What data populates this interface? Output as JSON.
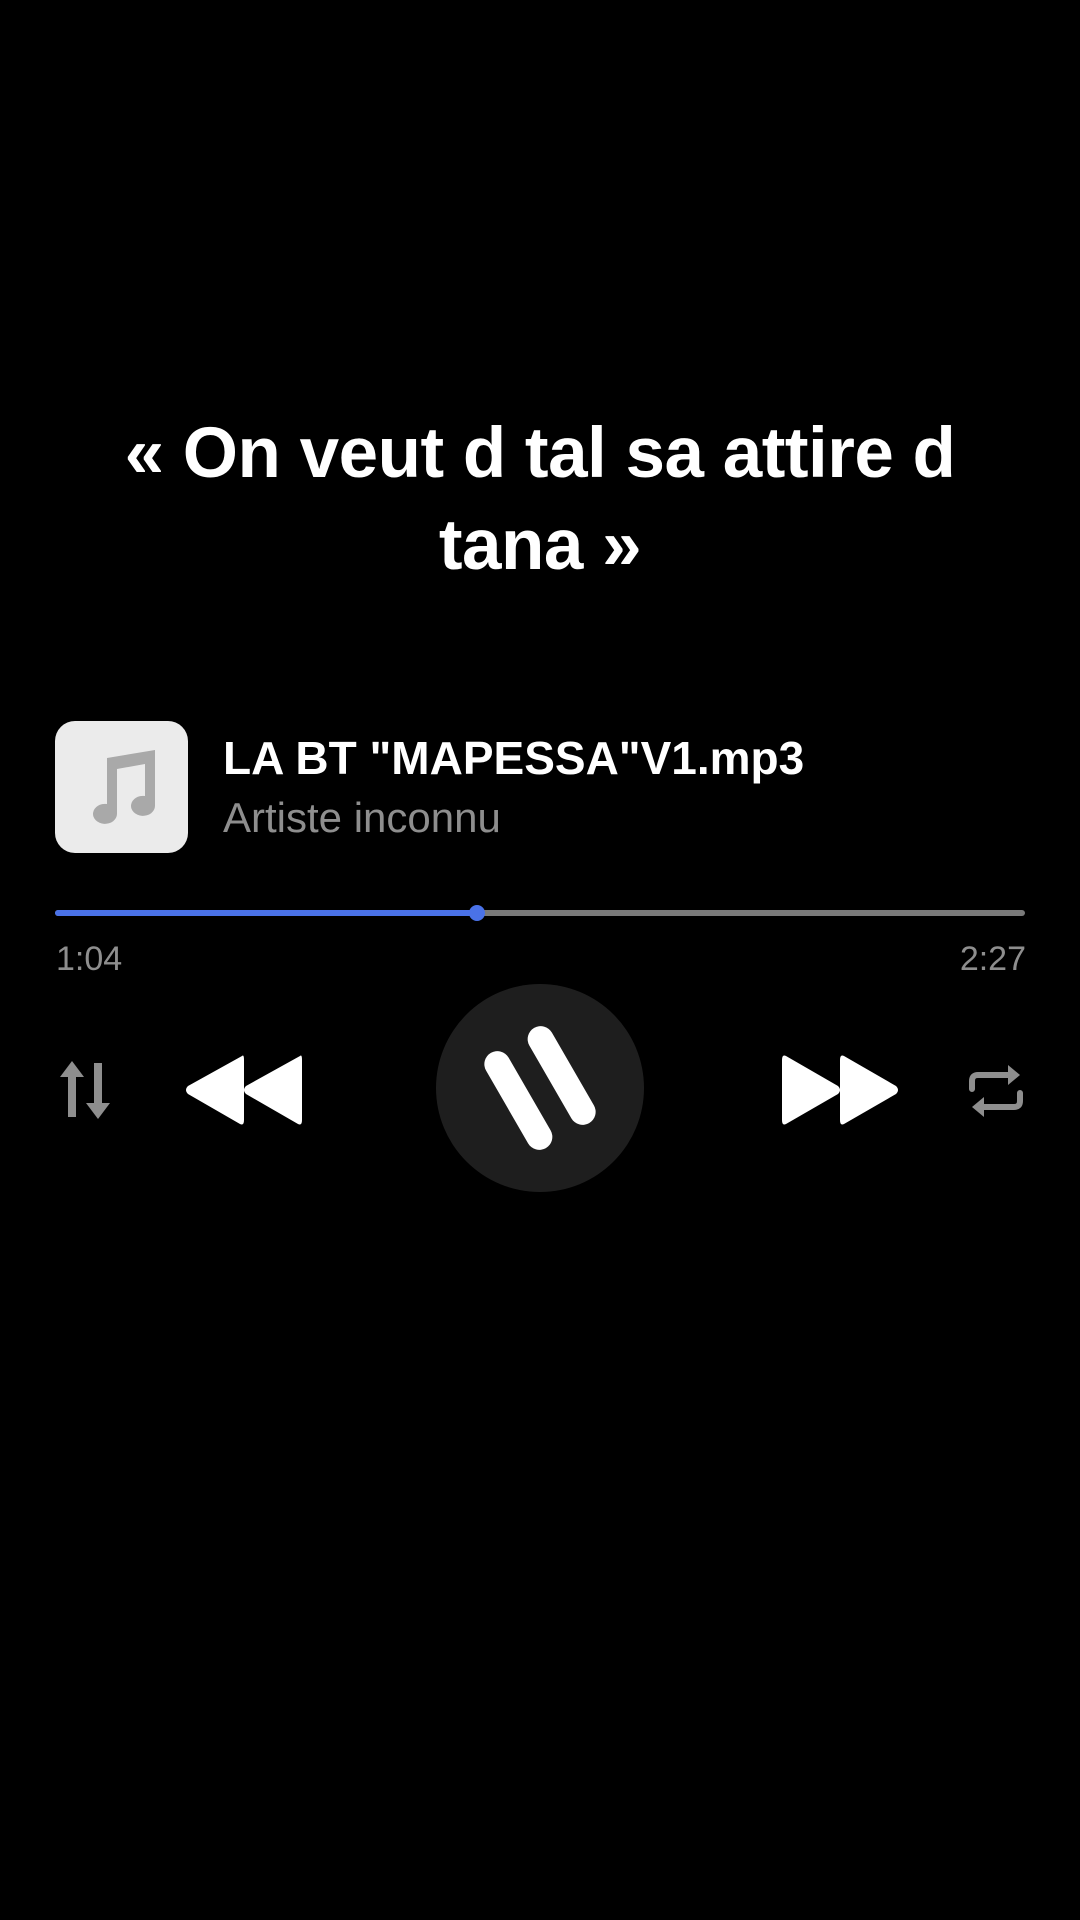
{
  "lyric": {
    "line1": "« On veut d tal sa attire d",
    "line2": "tana »"
  },
  "track": {
    "title": "LA BT \"MAPESSA\"V1.mp3",
    "artist": "Artiste inconnu",
    "artwork_icon": "music-note-icon"
  },
  "playback": {
    "current_time": "1:04",
    "total_time": "2:27",
    "progress_fraction": 0.4354,
    "state": "playing"
  },
  "controls": {
    "shuffle_icon": "sort-arrows-icon",
    "rewind_icon": "rewind-icon",
    "pause_icon": "pause-icon",
    "forward_icon": "fast-forward-icon",
    "repeat_icon": "repeat-icon"
  },
  "colors": {
    "background": "#000000",
    "accent": "#4a72e8",
    "secondary_text": "#8e8e8e",
    "track_bar": "#7a7a7a",
    "play_button_bg": "#1e1e1e"
  }
}
